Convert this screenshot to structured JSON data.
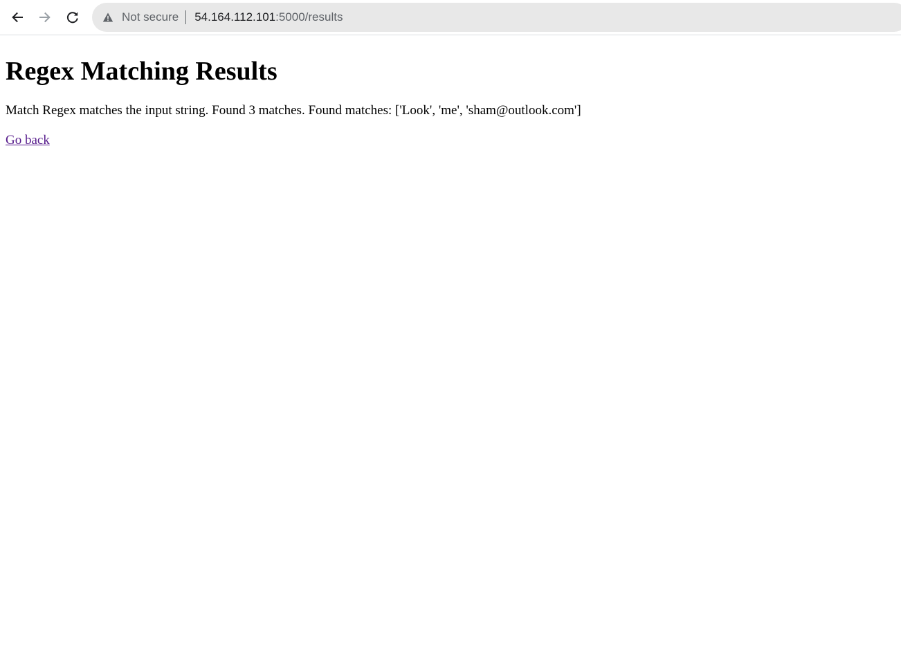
{
  "browser": {
    "security_label": "Not secure",
    "url_host": "54.164.112.101",
    "url_path": ":5000/results",
    "icons": {
      "back": "arrow-left-icon",
      "forward": "arrow-right-icon",
      "reload": "reload-icon",
      "security": "warning-triangle-icon"
    }
  },
  "page": {
    "title": "Regex Matching Results",
    "result_text": "Match Regex matches the input string. Found 3 matches. Found matches: ['Look', 'me', 'sham@outlook.com']",
    "back_link": "Go back"
  },
  "colors": {
    "omnibox_bg": "#e8e8e8",
    "visited_link": "#551a8b"
  }
}
